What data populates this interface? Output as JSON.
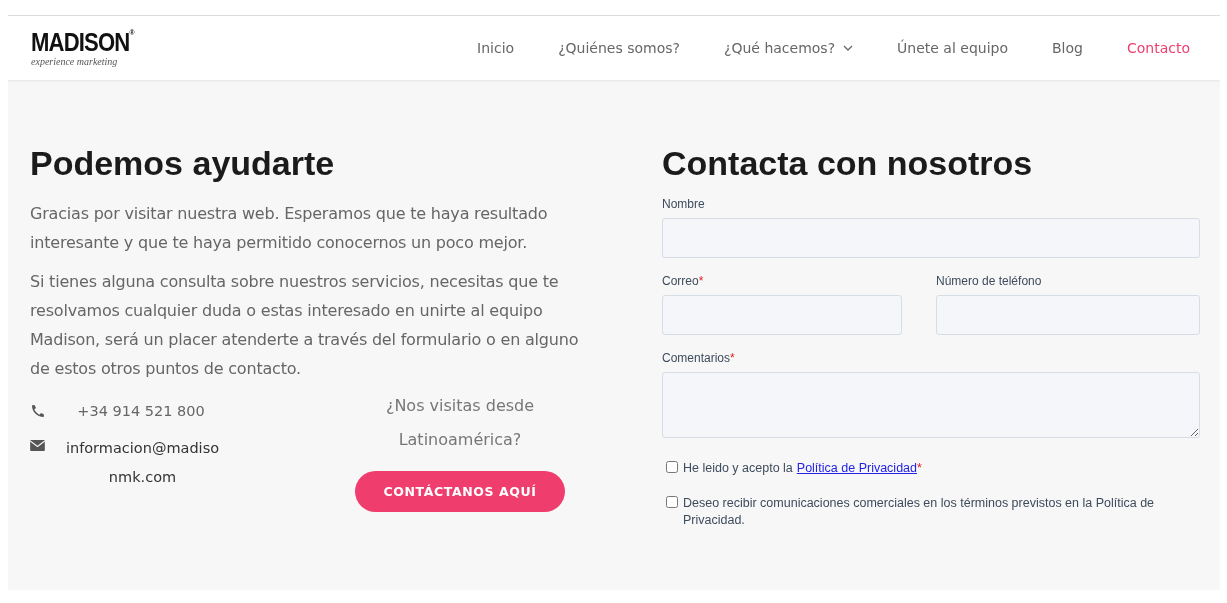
{
  "header": {
    "logo": {
      "name": "MADISON",
      "mark": "®",
      "tagline": "experience marketing"
    },
    "nav": [
      {
        "label": "Inicio",
        "selected": false,
        "has_dropdown": false
      },
      {
        "label": "¿Quiénes somos?",
        "selected": false,
        "has_dropdown": false
      },
      {
        "label": "¿Qué hacemos?",
        "selected": false,
        "has_dropdown": true
      },
      {
        "label": "Únete al equipo",
        "selected": false,
        "has_dropdown": false
      },
      {
        "label": "Blog",
        "selected": false,
        "has_dropdown": false
      },
      {
        "label": "Contacto",
        "selected": true,
        "has_dropdown": false
      }
    ]
  },
  "help": {
    "title": "Podemos ayudarte",
    "paragraphs": [
      "Gracias por visitar nuestra web. Esperamos que te haya resultado interesante y que te haya permitido conocernos un poco mejor.",
      "Si tienes alguna consulta sobre nuestros servicios, necesitas que te resolvamos cualquier duda o estas interesado en unirte al equipo Madison, será un placer atenderte a través del formulario o en alguno de estos otros puntos de contacto."
    ],
    "contacts": [
      {
        "kind": "phone",
        "text": "+34 914 521 800"
      },
      {
        "kind": "email",
        "text": "informacion@madisonmk.com"
      }
    ],
    "latam": {
      "question": "¿Nos visitas desde Latinoamérica?",
      "button": "CONTÁCTANOS AQUÍ"
    }
  },
  "form": {
    "title": "Contacta con nosotros",
    "fields": [
      {
        "label": "Nombre",
        "kind": "input"
      },
      {
        "label": "Correo",
        "required_mark": "*",
        "kind": "input"
      },
      {
        "label": "Número de teléfono",
        "kind": "input"
      },
      {
        "label": "Comentarios",
        "required_mark": "*",
        "kind": "textarea"
      }
    ],
    "consents": [
      {
        "checked": false,
        "text": "He leido y acepto la",
        "link": "Política de Privacidad",
        "required_mark": "*"
      },
      {
        "checked": false,
        "text": "Deseo recibir comunicaciones comerciales en los términos previstos en la Política de Privacidad."
      }
    ]
  }
}
